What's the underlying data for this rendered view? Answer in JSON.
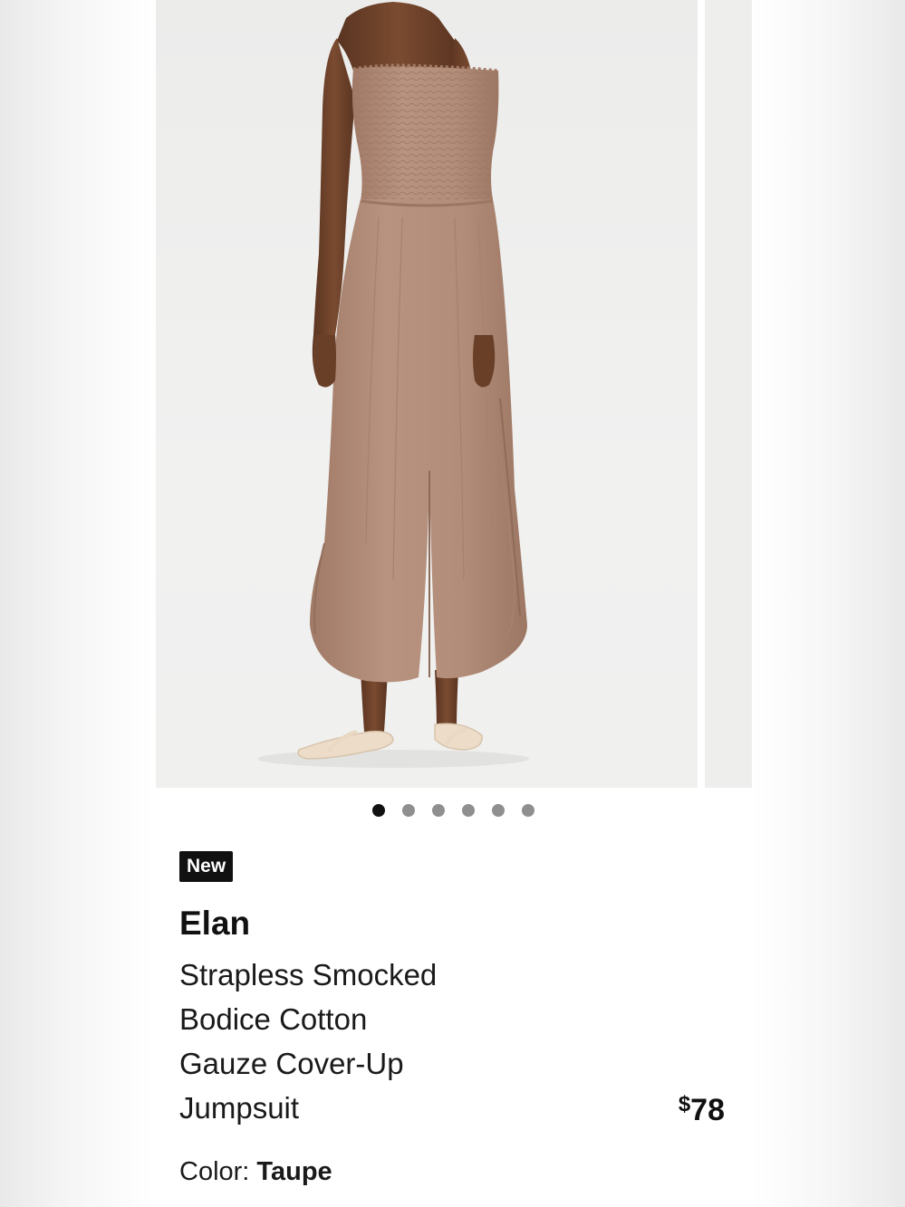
{
  "product": {
    "badge": "New",
    "brand": "Elan",
    "title_lines": [
      "Strapless Smocked",
      "Bodice Cotton",
      "Gauze Cover-Up",
      "Jumpsuit"
    ],
    "price_symbol": "$",
    "price_amount": "78",
    "color_label": "Color:",
    "color_value": "Taupe"
  },
  "carousel": {
    "slide_count": 6,
    "active_index": 0
  },
  "colors": {
    "garment": "#b18c78",
    "skin": "#6b4128",
    "sandal": "#ecdcc8",
    "text": "#1a1a1a",
    "badge_bg": "#111111",
    "dot_active": "#111111",
    "dot_inactive": "#8f8f8f"
  },
  "icons": {
    "carousel_dot": "circle"
  }
}
